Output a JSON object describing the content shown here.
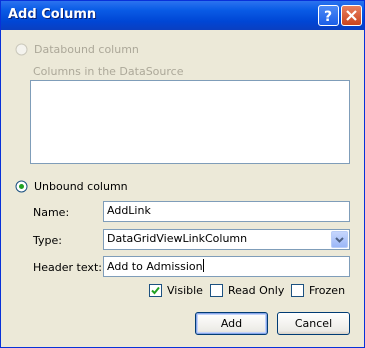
{
  "window": {
    "title": "Add Column"
  },
  "databound": {
    "label": "Databound column",
    "columns_label": "Columns in the DataSource"
  },
  "unbound": {
    "label": "Unbound column"
  },
  "form": {
    "name_label": "Name:",
    "name_value": "AddLink",
    "type_label": "Type:",
    "type_value": "DataGridViewLinkColumn",
    "header_label": "Header text:",
    "header_value": "Add to Admission"
  },
  "options": {
    "visible_label": "Visible",
    "visible_checked": true,
    "readonly_label": "Read Only",
    "readonly_checked": false,
    "frozen_label": "Frozen",
    "frozen_checked": false
  },
  "buttons": {
    "add": "Add",
    "cancel": "Cancel"
  }
}
